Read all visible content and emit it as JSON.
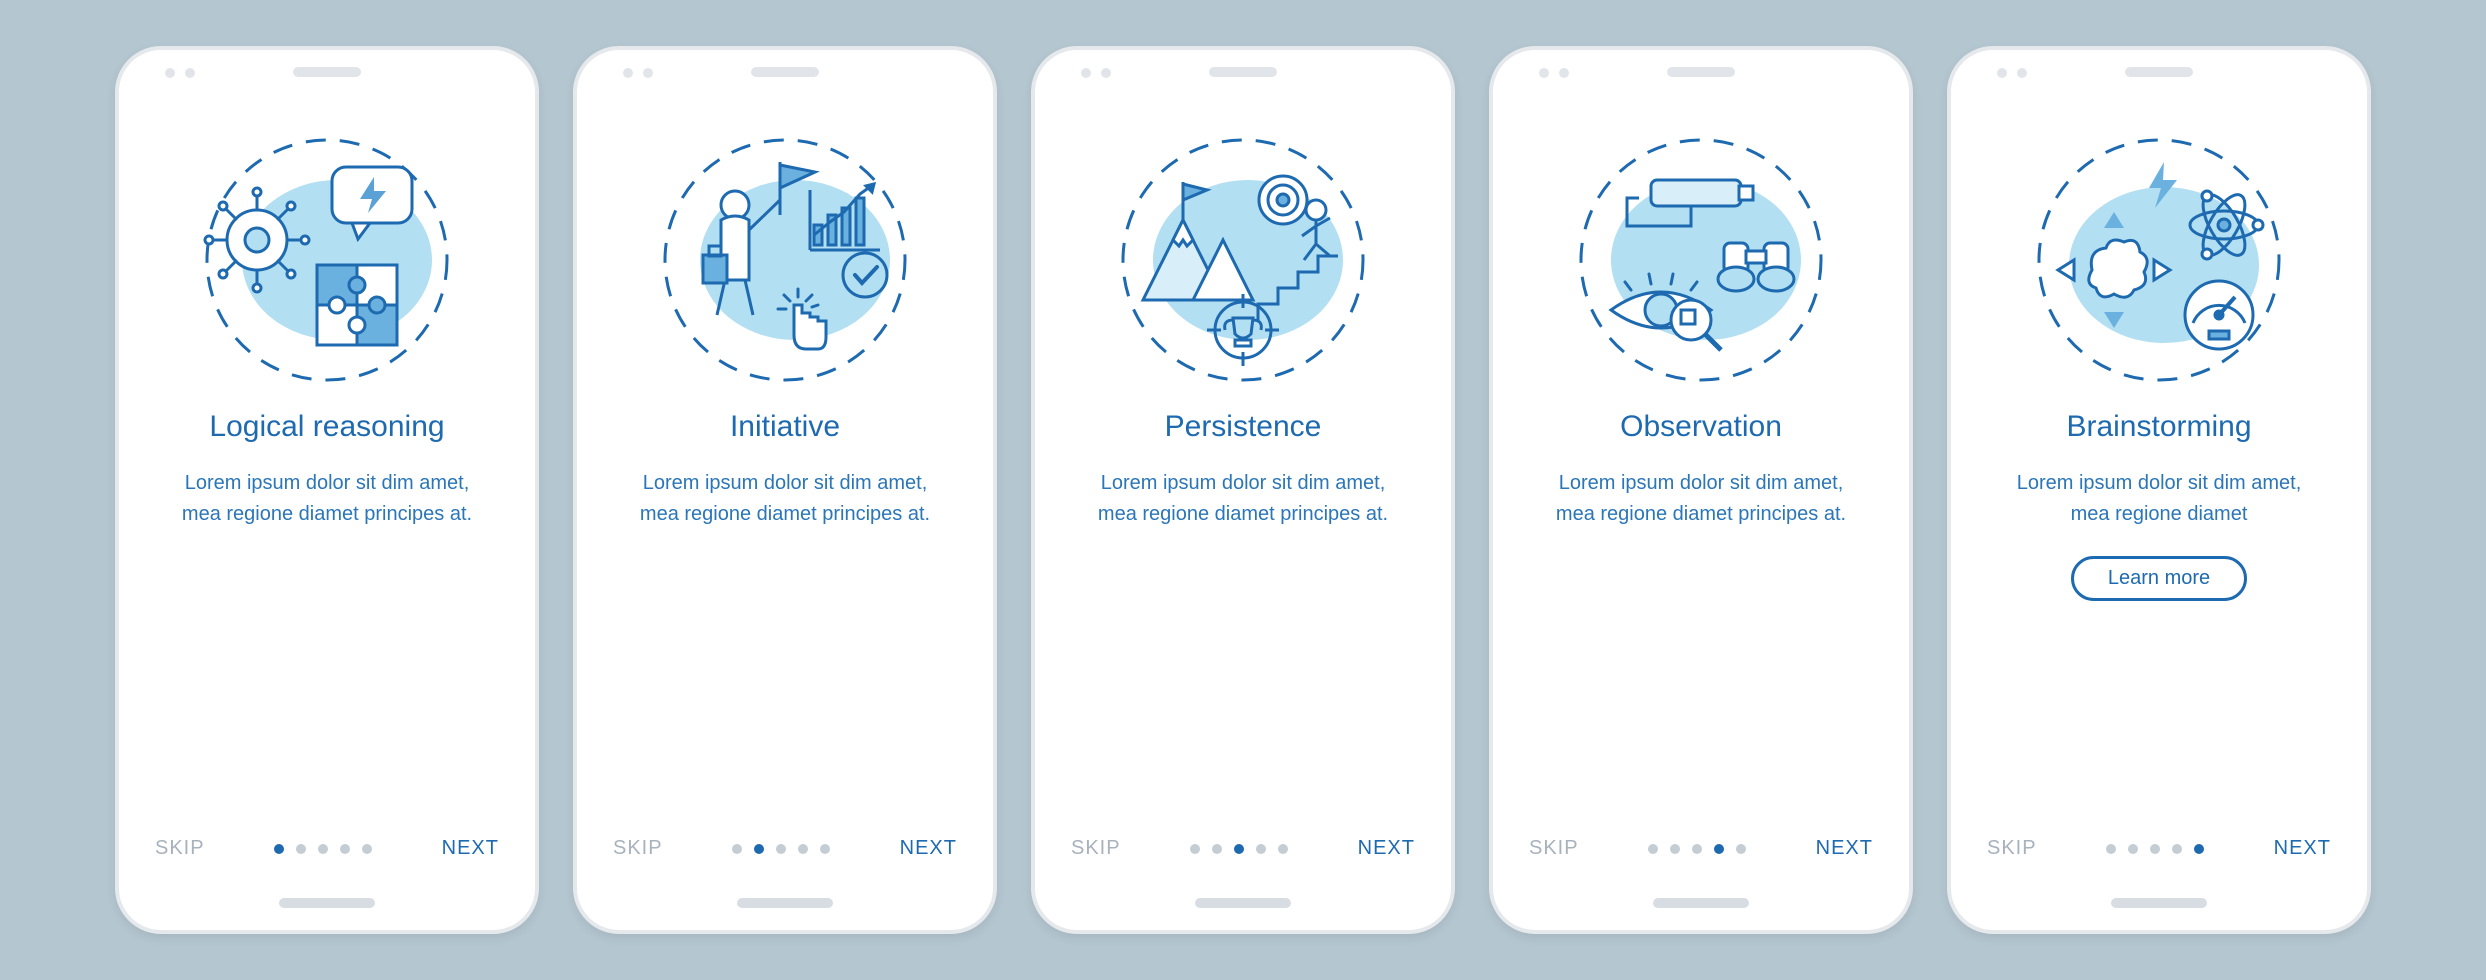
{
  "colors": {
    "accent": "#1e6ab0",
    "light_blue": "#87c7e8",
    "fill_blue": "#b3dff2",
    "grey": "#b4c6d0"
  },
  "common": {
    "skip_label": "SKIP",
    "next_label": "NEXT",
    "learn_label": "Learn more",
    "total_dots": 5
  },
  "screens": [
    {
      "icon": "gear-puzzle-bolt-icon",
      "title": "Logical reasoning",
      "desc": "Lorem ipsum dolor sit dim amet, mea regione diamet principes at.",
      "active_index": 0,
      "has_learn": false
    },
    {
      "icon": "person-flag-chart-icon",
      "title": "Initiative",
      "desc": "Lorem ipsum dolor sit dim amet, mea regione diamet principes at.",
      "active_index": 1,
      "has_learn": false
    },
    {
      "icon": "mountain-stairs-trophy-icon",
      "title": "Persistence",
      "desc": "Lorem ipsum dolor sit dim amet, mea regione diamet principes at.",
      "active_index": 2,
      "has_learn": false
    },
    {
      "icon": "eye-camera-binoculars-icon",
      "title": "Observation",
      "desc": "Lorem ipsum dolor sit dim amet, mea regione diamet principes at.",
      "active_index": 3,
      "has_learn": false
    },
    {
      "icon": "brain-atom-gauge-icon",
      "title": "Brainstorming",
      "desc": "Lorem ipsum dolor sit dim amet, mea regione diamet",
      "active_index": 4,
      "has_learn": true
    }
  ]
}
